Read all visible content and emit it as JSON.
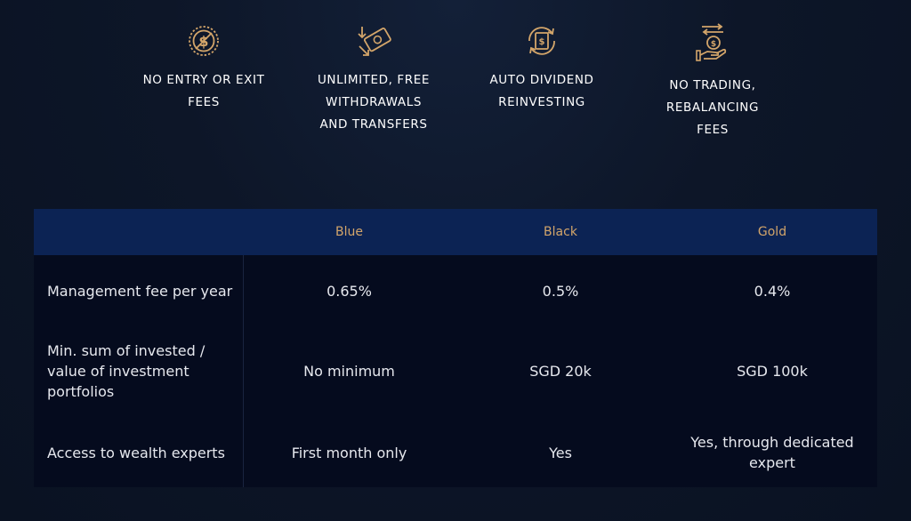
{
  "colors": {
    "gold": "#d3a56a",
    "header_bg": "#0c2354",
    "table_bg": "#050b1e",
    "page_bg": "#0d1628"
  },
  "features": [
    {
      "icon": "dollar-coin-crossed-icon",
      "label": "NO ENTRY OR EXIT\nFEES"
    },
    {
      "icon": "cash-transfer-icon",
      "label": "UNLIMITED, FREE\nWITHDRAWALS\nAND TRANSFERS"
    },
    {
      "icon": "reinvest-cycle-icon",
      "label": "AUTO DIVIDEND\nREINVESTING"
    },
    {
      "icon": "hand-coin-exchange-icon",
      "label": "NO TRADING,\nREBALANCING\nFEES"
    }
  ],
  "table": {
    "columns": [
      "",
      "Blue",
      "Black",
      "Gold"
    ],
    "rows": [
      {
        "label": "Management fee per year",
        "values": [
          "0.65%",
          "0.5%",
          "0.4%"
        ]
      },
      {
        "label": "Min. sum of invested / value of investment portfolios",
        "values": [
          "No minimum",
          "SGD 20k",
          "SGD 100k"
        ]
      },
      {
        "label": "Access to wealth experts",
        "values": [
          "First month only",
          "Yes",
          "Yes, through dedicated expert"
        ]
      }
    ]
  }
}
